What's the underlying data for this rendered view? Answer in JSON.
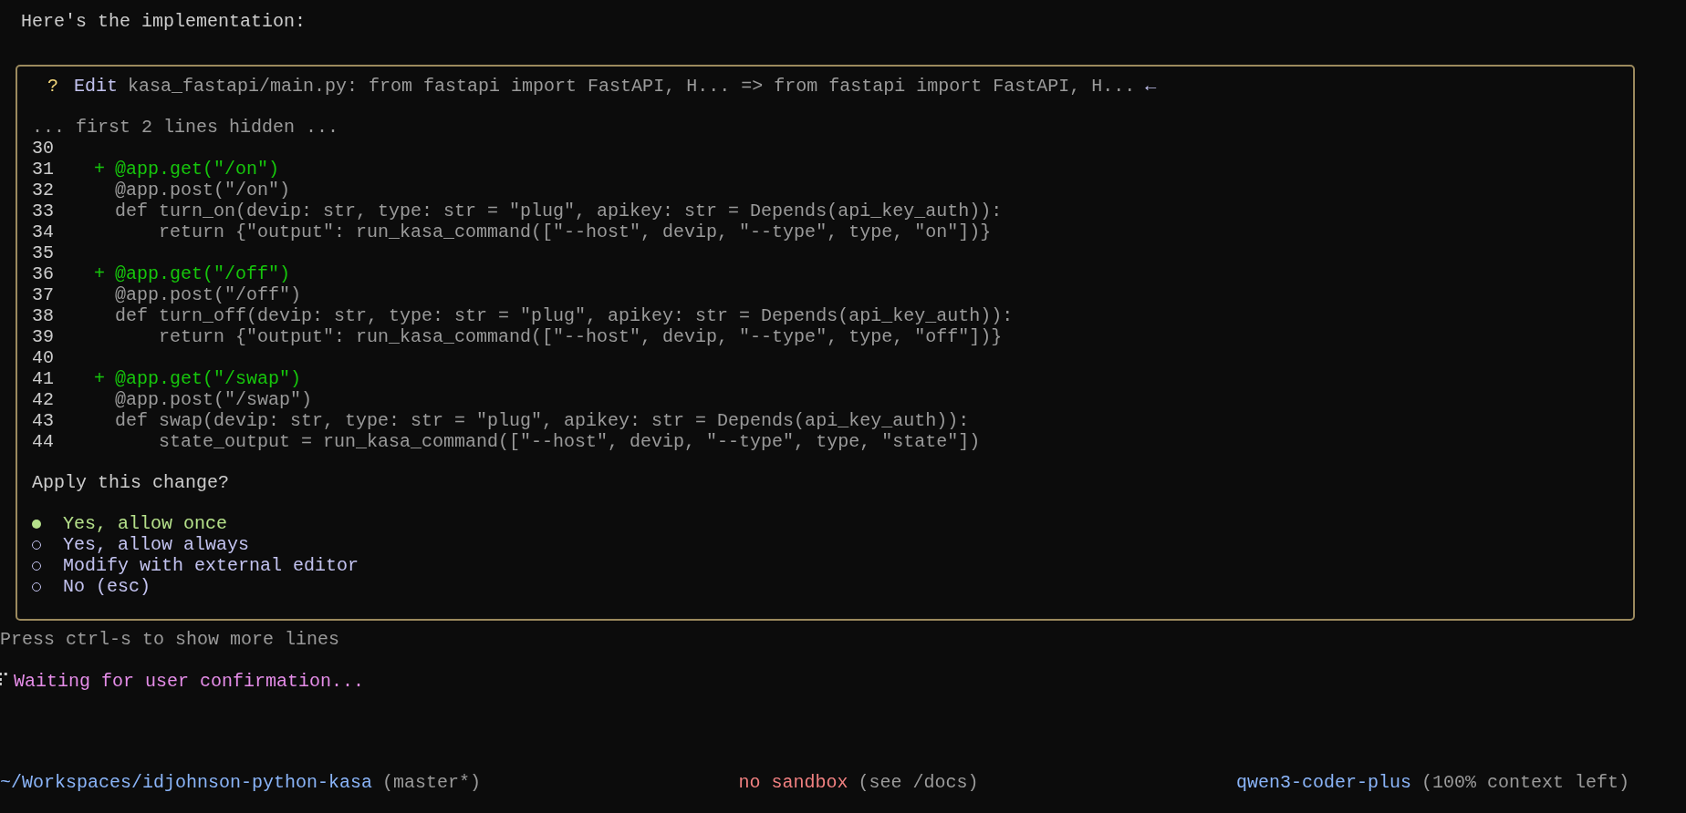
{
  "intro": "Here's the implementation:",
  "dialog": {
    "marker": "?",
    "action": "Edit",
    "summary": "kasa_fastapi/main.py: from fastapi import FastAPI, H... => from fastapi import FastAPI, H...",
    "arrow": "←",
    "hidden_note": "... first 2 lines hidden ...",
    "lines": [
      {
        "number": "30",
        "kind": "context"
      },
      {
        "number": "31",
        "kind": "added",
        "marker": "+",
        "text": "@app.get(\"/on\")"
      },
      {
        "number": "32",
        "kind": "context",
        "text": "@app.post(\"/on\")"
      },
      {
        "number": "33",
        "kind": "context",
        "text": "def turn_on(devip: str, type: str = \"plug\", apikey: str = Depends(api_key_auth)):"
      },
      {
        "number": "34",
        "kind": "context",
        "text": "    return {\"output\": run_kasa_command([\"--host\", devip, \"--type\", type, \"on\"])}"
      },
      {
        "number": "35",
        "kind": "context"
      },
      {
        "number": "36",
        "kind": "added",
        "marker": "+",
        "text": "@app.get(\"/off\")"
      },
      {
        "number": "37",
        "kind": "context",
        "text": "@app.post(\"/off\")"
      },
      {
        "number": "38",
        "kind": "context",
        "text": "def turn_off(devip: str, type: str = \"plug\", apikey: str = Depends(api_key_auth)):"
      },
      {
        "number": "39",
        "kind": "context",
        "text": "    return {\"output\": run_kasa_command([\"--host\", devip, \"--type\", type, \"off\"])}"
      },
      {
        "number": "40",
        "kind": "context"
      },
      {
        "number": "41",
        "kind": "added",
        "marker": "+",
        "text": "@app.get(\"/swap\")"
      },
      {
        "number": "42",
        "kind": "context",
        "text": "@app.post(\"/swap\")"
      },
      {
        "number": "43",
        "kind": "context",
        "text": "def swap(devip: str, type: str = \"plug\", apikey: str = Depends(api_key_auth)):"
      },
      {
        "number": "44",
        "kind": "context",
        "text": "    state_output = run_kasa_command([\"--host\", devip, \"--type\", type, \"state\"])"
      }
    ],
    "question": "Apply this change?",
    "options": [
      {
        "label": "Yes, allow once",
        "selected": true
      },
      {
        "label": "Yes, allow always",
        "selected": false
      },
      {
        "label": "Modify with external editor",
        "selected": false
      },
      {
        "label": "No (esc)",
        "selected": false
      }
    ]
  },
  "hint": "Press ctrl-s to show more lines",
  "status": {
    "spinner": "⠏",
    "text": "Waiting for user confirmation..."
  },
  "footer": {
    "path": "~/Workspaces/idjohnson-python-kasa",
    "branch": "(master*)",
    "sandbox": "no sandbox",
    "sandbox_note": "(see /docs)",
    "model": "qwen3-coder-plus",
    "context": "(100% context left)"
  }
}
